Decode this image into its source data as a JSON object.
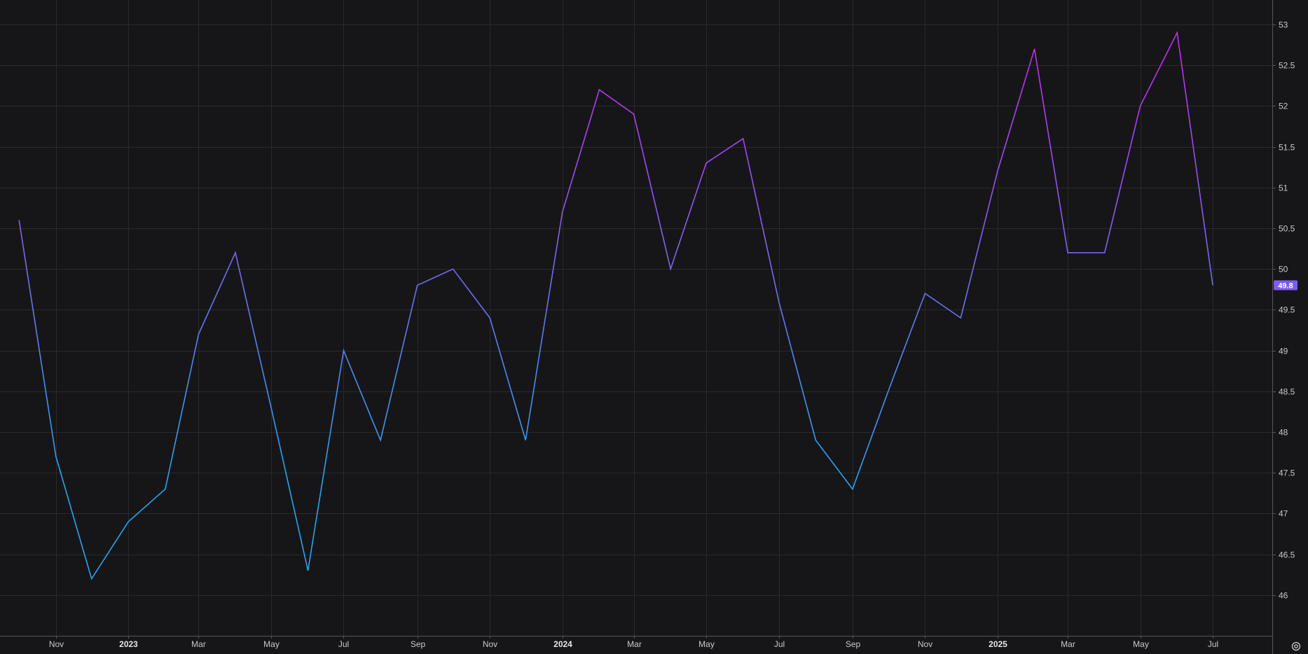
{
  "chart_data": {
    "type": "line",
    "title": "",
    "xlabel": "",
    "ylabel": "",
    "ylim": [
      45.5,
      53.3
    ],
    "y_ticks": [
      46,
      46.5,
      47,
      47.5,
      48,
      48.5,
      49,
      49.5,
      50,
      50.5,
      51,
      51.5,
      52,
      52.5,
      53
    ],
    "x_range": [
      "2022-09-15",
      "2025-08-20"
    ],
    "x_ticks": [
      {
        "label": "Nov",
        "date": "2022-11-01",
        "year": false
      },
      {
        "label": "2023",
        "date": "2023-01-01",
        "year": true
      },
      {
        "label": "Mar",
        "date": "2023-03-01",
        "year": false
      },
      {
        "label": "May",
        "date": "2023-05-01",
        "year": false
      },
      {
        "label": "Jul",
        "date": "2023-07-01",
        "year": false
      },
      {
        "label": "Sep",
        "date": "2023-09-01",
        "year": false
      },
      {
        "label": "Nov",
        "date": "2023-11-01",
        "year": false
      },
      {
        "label": "2024",
        "date": "2024-01-01",
        "year": true
      },
      {
        "label": "Mar",
        "date": "2024-03-01",
        "year": false
      },
      {
        "label": "May",
        "date": "2024-05-01",
        "year": false
      },
      {
        "label": "Jul",
        "date": "2024-07-01",
        "year": false
      },
      {
        "label": "Sep",
        "date": "2024-09-01",
        "year": false
      },
      {
        "label": "Nov",
        "date": "2024-11-01",
        "year": false
      },
      {
        "label": "2025",
        "date": "2025-01-01",
        "year": true
      },
      {
        "label": "Mar",
        "date": "2025-03-01",
        "year": false
      },
      {
        "label": "May",
        "date": "2025-05-01",
        "year": false
      },
      {
        "label": "Jul",
        "date": "2025-07-01",
        "year": false
      }
    ],
    "grid": true,
    "series": [
      {
        "x": [
          "2022-10-01",
          "2022-11-01",
          "2022-12-01",
          "2023-01-01",
          "2023-02-01",
          "2023-03-01",
          "2023-04-01",
          "2023-05-01",
          "2023-06-01",
          "2023-07-01",
          "2023-08-01",
          "2023-09-01",
          "2023-10-01",
          "2023-11-01",
          "2023-12-01",
          "2024-01-01",
          "2024-02-01",
          "2024-03-01",
          "2024-04-01",
          "2024-05-01",
          "2024-06-01",
          "2024-07-01",
          "2024-08-01",
          "2024-09-01",
          "2024-10-01",
          "2024-11-01",
          "2024-12-01",
          "2025-01-01",
          "2025-02-01",
          "2025-03-01",
          "2025-04-01",
          "2025-05-01",
          "2025-06-01",
          "2025-07-01"
        ],
        "values": [
          50.6,
          47.7,
          46.2,
          46.9,
          47.3,
          49.2,
          50.2,
          48.3,
          46.3,
          49.0,
          47.9,
          49.8,
          50.0,
          49.4,
          47.9,
          50.7,
          52.2,
          51.9,
          50.0,
          51.3,
          51.6,
          49.6,
          47.9,
          47.3,
          48.5,
          49.7,
          49.4,
          51.2,
          52.7,
          50.2,
          50.2,
          52.0,
          52.9,
          49.8
        ]
      }
    ],
    "last_value": "49.8",
    "colors": {
      "background": "#161618",
      "grid": "#2a2a2d",
      "line_low": "#29a3f0",
      "line_high": "#c12ef2",
      "last_badge": "#7b5cf5",
      "text": "#c9c9cc"
    }
  },
  "icons": {
    "settings": "settings-icon"
  }
}
